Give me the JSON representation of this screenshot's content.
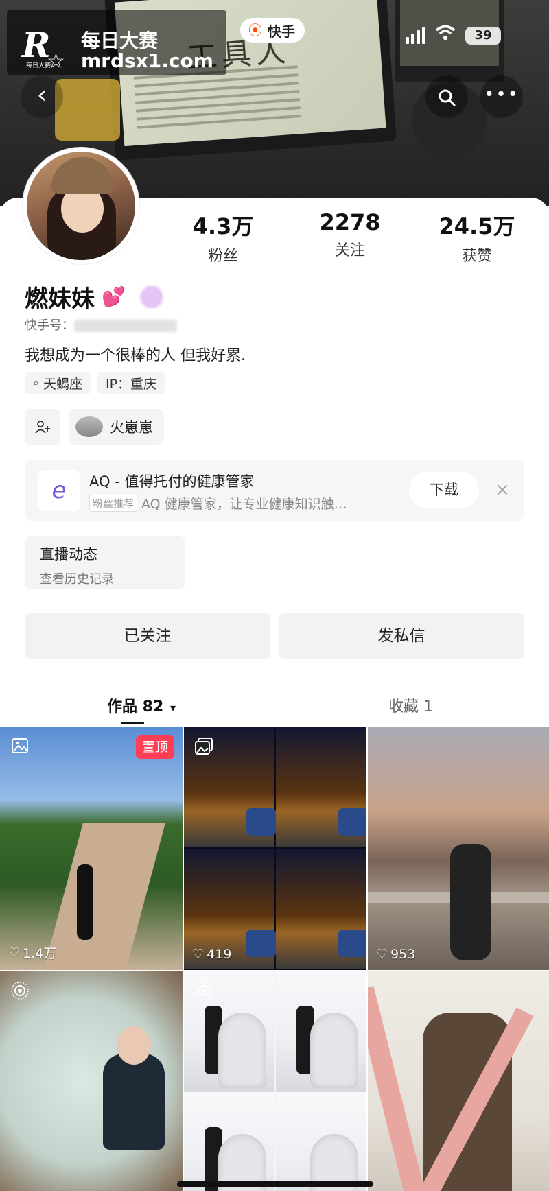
{
  "watermark": {
    "logo": "R",
    "logo_small": "每日大赛",
    "title": "每日大赛",
    "site": "mrdsx1.com"
  },
  "app_chip": {
    "icon": "kuaishou-logo-icon",
    "label": "快手"
  },
  "status_bar": {
    "battery": "39",
    "signal": "signal-icon",
    "wifi": "wifi-icon"
  },
  "cover": {
    "screen_text": "工具人"
  },
  "profile": {
    "name": "燃妹妹",
    "name_emoji": "💕",
    "id_label": "快手号：",
    "bio": "我想成为一个很棒的人 但我好累.",
    "stats": [
      {
        "value": "4.3万",
        "label": "粉丝"
      },
      {
        "value": "2278",
        "label": "关注"
      },
      {
        "value": "24.5万",
        "label": "获赞"
      }
    ],
    "tags": [
      {
        "icon": "search-icon",
        "text": "天蝎座"
      },
      {
        "text": "IP：重庆"
      }
    ],
    "mutual_friend": "火崽崽"
  },
  "ad": {
    "title": "AQ - 值得托付的健康管家",
    "pill": "粉丝推荐",
    "subtitle": "AQ 健康管家，让专业健康知识触…",
    "download": "下载",
    "close": "×"
  },
  "live": {
    "title": "直播动态",
    "subtitle": "查看历史记录"
  },
  "actions": {
    "followed": "已关注",
    "message": "发私信"
  },
  "tabs": {
    "works": "作品 82",
    "works_caret": "▾",
    "favorites": "收藏 1"
  },
  "posts": [
    {
      "type": "image",
      "pinned": "置顶",
      "likes": "1.4万"
    },
    {
      "type": "album",
      "likes": "419"
    },
    {
      "type": "video",
      "likes": "953"
    },
    {
      "type": "live-photo",
      "likes": ""
    },
    {
      "type": "live-photo",
      "likes": ""
    },
    {
      "type": "video",
      "likes": ""
    }
  ]
}
